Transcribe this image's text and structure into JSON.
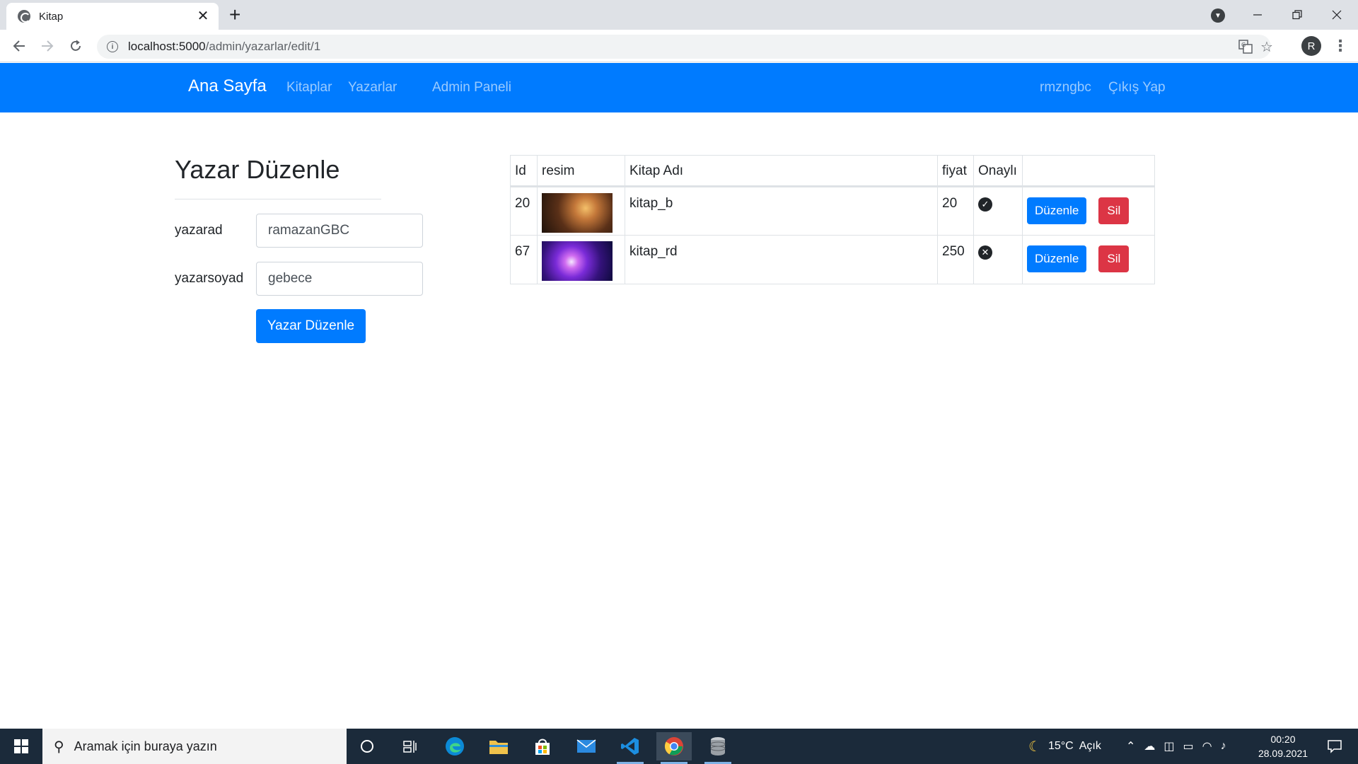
{
  "browser": {
    "tab_title": "Kitap",
    "tab_close": "✕",
    "new_tab": "+",
    "url_host": "localhost:5000",
    "url_path": "/admin/yazarlar/edit/1",
    "profile_initial": "R"
  },
  "navbar": {
    "brand": "Ana Sayfa",
    "links": [
      "Kitaplar",
      "Yazarlar",
      "Admin Paneli"
    ],
    "user": "rmzngbc",
    "logout": "Çıkış Yap",
    "bg_color": "#007bff"
  },
  "form": {
    "title": "Yazar Düzenle",
    "fields": [
      {
        "label": "yazarad",
        "value": "ramazanGBC"
      },
      {
        "label": "yazarsoyad",
        "value": "gebece"
      }
    ],
    "submit_label": "Yazar Düzenle"
  },
  "table": {
    "headers": [
      "Id",
      "resim",
      "Kitap Adı",
      "fiyat",
      "Onaylı",
      ""
    ],
    "rows": [
      {
        "id": "20",
        "image": "warm-figure-photo",
        "name": "kitap_b",
        "price": "20",
        "approved": true,
        "edit_label": "Düzenle",
        "delete_label": "Sil"
      },
      {
        "id": "67",
        "image": "purple-nebula-photo",
        "name": "kitap_rd",
        "price": "250",
        "approved": false,
        "edit_label": "Düzenle",
        "delete_label": "Sil"
      }
    ],
    "approved_icon": "check-circle-icon",
    "rejected_icon": "times-circle-icon",
    "edit_color": "#007bff",
    "delete_color": "#dc3545"
  },
  "taskbar": {
    "search_placeholder": "Aramak için buraya yazın",
    "weather": "15°C  Açık",
    "time": "00:20",
    "date": "28.09.2021"
  }
}
